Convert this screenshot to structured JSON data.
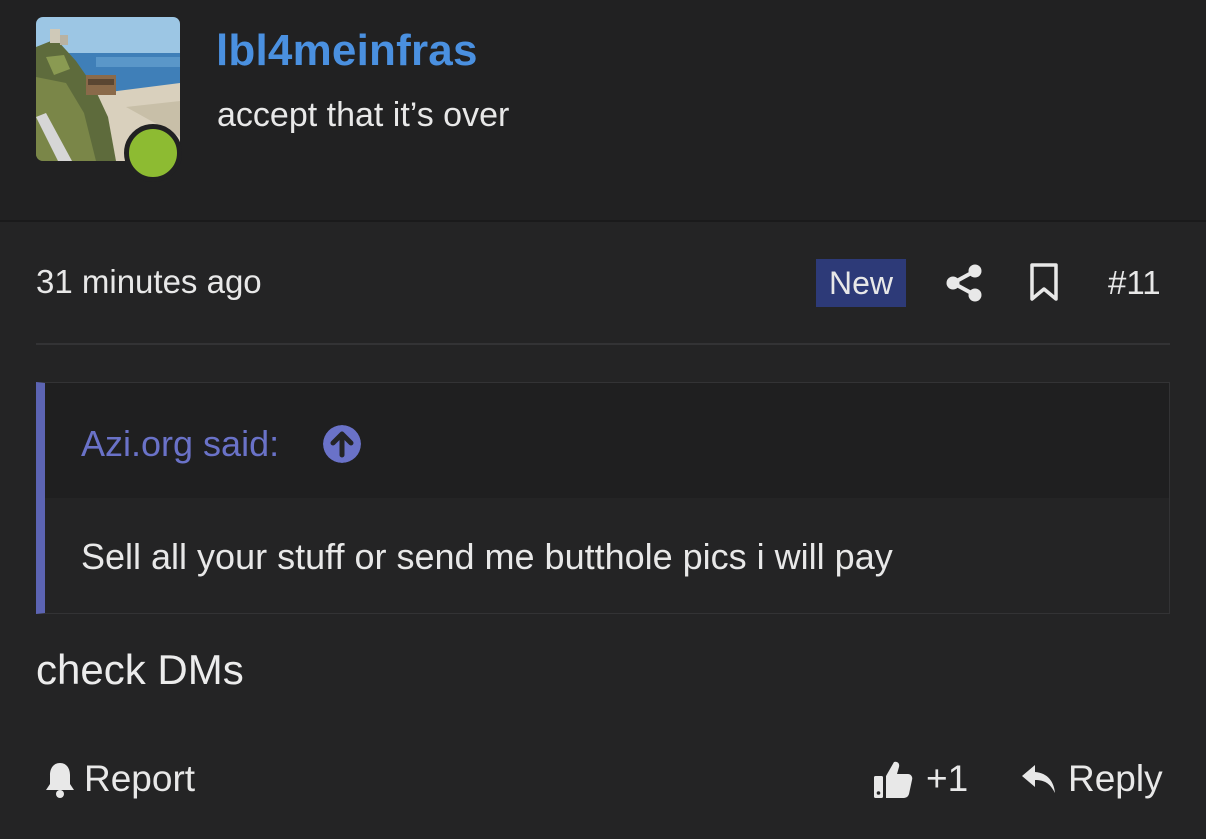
{
  "user": {
    "username": "lbl4meinfras",
    "title": "accept that it’s over",
    "online": true,
    "online_color": "#8dbb32"
  },
  "post": {
    "timestamp": "31 minutes ago",
    "badge": "New",
    "number": "#11",
    "message": "check DMs",
    "icons": [
      "share-icon",
      "bookmark-icon"
    ]
  },
  "quote": {
    "author_label": "Azi.org said:",
    "text": "Sell all your stuff or send me butthole pics i will pay",
    "accent_color": "#5c64b3"
  },
  "actions": {
    "report_label": "Report",
    "like_count": "+1",
    "reply_label": "Reply"
  },
  "colors": {
    "username": "#4a90e0",
    "badge_bg": "#2d3a78",
    "background": "#242425"
  }
}
